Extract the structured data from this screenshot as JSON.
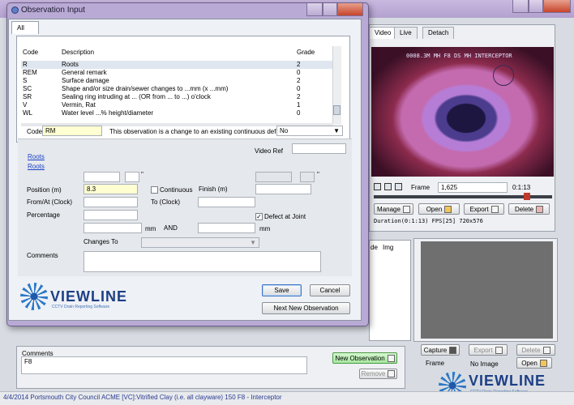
{
  "dialog": {
    "title": "Observation Input",
    "tab_all": "All",
    "list": {
      "headers": {
        "code": "Code",
        "description": "Description",
        "grade": "Grade"
      },
      "rows": [
        {
          "code": "R",
          "description": "Roots",
          "grade": "2"
        },
        {
          "code": "REM",
          "description": "General remark",
          "grade": "0"
        },
        {
          "code": "S",
          "description": "Surface damage",
          "grade": "2"
        },
        {
          "code": "SC",
          "description": "Shape and/or size drain/sewer changes to ...mm (x ...mm)",
          "grade": "0"
        },
        {
          "code": "SR",
          "description": "Sealing ring intruding at ... (OR from ... to ...) o'clock",
          "grade": "2"
        },
        {
          "code": "V",
          "description": "Vermin, Rat",
          "grade": "1"
        },
        {
          "code": "WL",
          "description": "Water level ...% height/diameter",
          "grade": "0"
        }
      ]
    },
    "code_label": "Code",
    "code_value": "RM",
    "continuous_label": "This observation is a change to an existing continuous defect",
    "continuous_select": "No",
    "video_ref_label": "Video Ref",
    "links": [
      "Roots",
      "Roots"
    ],
    "position_label": "Position (m)",
    "position_value": "8.3",
    "continuous_checkbox": "Continuous",
    "finish_label": "Finish (m)",
    "from_at_label": "From/At (Clock)",
    "to_clock_label": "To (Clock)",
    "percentage_label": "Percentage",
    "defect_joint_label": "Defect at Joint",
    "mm_label_1": "mm",
    "and_label": "AND",
    "mm_label_2": "mm",
    "changes_to_label": "Changes To",
    "comments_label": "Comments",
    "save_label": "Save",
    "cancel_label": "Cancel",
    "next_label": "Next New Observation",
    "inch_mark": "\""
  },
  "logo": {
    "word": "VIEWLINE",
    "tagline": "CCTV Drain Reporting Software"
  },
  "video": {
    "tabs": [
      "Video",
      "Live",
      "Detach"
    ],
    "overlay_text": "0008.3M   MH F8 DS MH INTERCEPTOR",
    "frame_label": "Frame",
    "frame_value": "1,625",
    "time_value": "0:1:13",
    "duration_text": "Duration(0:1:13) FPS[25] 720x576",
    "manage_label": "Manage",
    "open_label": "Open",
    "export_label": "Export",
    "delete_label": "Delete"
  },
  "images": {
    "columns": [
      "de",
      "Img"
    ],
    "capture_label": "Capture",
    "export_label": "Export",
    "delete_label": "Delete",
    "frame_label": "Frame",
    "no_image_label": "No Image",
    "open_label": "Open"
  },
  "bottom": {
    "comments_label": "Comments",
    "comments_value": "F8",
    "new_observation_label": "New Observation",
    "remove_label": "Remove"
  },
  "status_bar": "4/4/2014  Portsmouth City Council  ACME  [VC]:Vitrified Clay (i.e. all clayware)  150  F8 - Interceptor",
  "colors": {
    "dialog_frame": "#b9aad5",
    "field_highlight": "#ffffd2",
    "new_obs_green": "#b9f0b4",
    "link_blue": "#1a40c8"
  }
}
